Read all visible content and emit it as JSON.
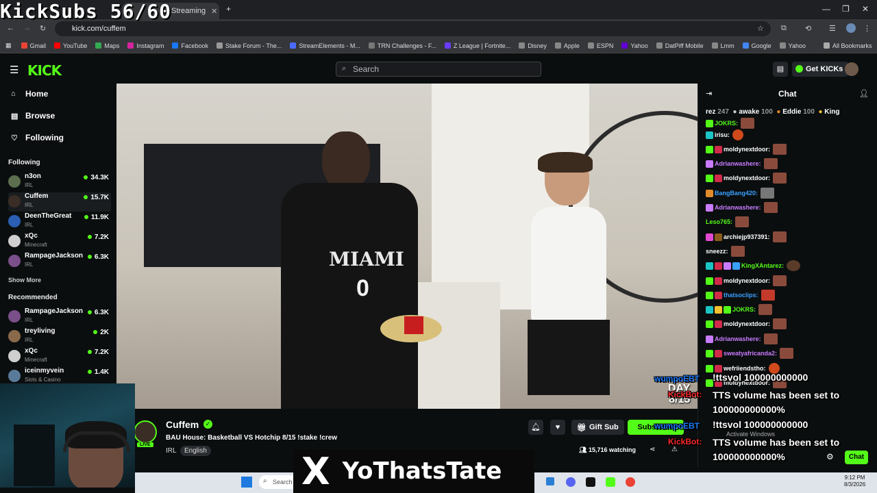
{
  "overlay_title": "KickSubs 56/60",
  "browser": {
    "tabs": [
      "Streaming"
    ],
    "url": "kick.com/cuffem",
    "bookmarks": [
      "Gmail",
      "YouTube",
      "Maps",
      "Instagram",
      "Facebook",
      "Stake Forum - The...",
      "StreamElements - M...",
      "TRN Challenges - F...",
      "Z League | Fortnite...",
      "Disney",
      "Apple",
      "ESPN",
      "Yahoo",
      "DatPiff Mobile",
      "Lmm",
      "Google",
      "Yahoo"
    ],
    "all_bookmarks": "All Bookmarks"
  },
  "kick": {
    "logo": "KICK",
    "search_placeholder": "Search",
    "get_kicks": "Get KICKs"
  },
  "sidebar": {
    "nav": [
      {
        "label": "Home",
        "icon": "home-icon"
      },
      {
        "label": "Browse",
        "icon": "browse-icon"
      },
      {
        "label": "Following",
        "icon": "heart-icon"
      }
    ],
    "following_title": "Following",
    "following": [
      {
        "name": "n3on",
        "category": "IRL",
        "viewers": "34.3K"
      },
      {
        "name": "Cuffem",
        "category": "IRL",
        "viewers": "15.7K"
      },
      {
        "name": "DeenTheGreat",
        "category": "IRL",
        "viewers": "11.9K"
      },
      {
        "name": "xQc",
        "category": "Minecraft",
        "viewers": "7.2K"
      },
      {
        "name": "RampageJackson",
        "category": "IRL",
        "viewers": "6.3K"
      }
    ],
    "show_more": "Show More",
    "recommended_title": "Recommended",
    "recommended": [
      {
        "name": "RampageJackson",
        "category": "IRL",
        "viewers": "6.3K"
      },
      {
        "name": "treyliving",
        "category": "IRL",
        "viewers": "2K"
      },
      {
        "name": "xQc",
        "category": "Minecraft",
        "viewers": "7.2K"
      },
      {
        "name": "iceinmyvein",
        "category": "Slots & Casino",
        "viewers": "1.4K"
      }
    ]
  },
  "video": {
    "day_label": "DAY",
    "day_count": "8/15"
  },
  "stream": {
    "streamer": "Cuffem",
    "live": "LIVE",
    "title": "BAU House: Basketball VS Hotchip 8/15 !stake !crew",
    "tags": [
      "IRL",
      "English"
    ],
    "gift_sub": "Gift Sub",
    "subscribe": "Subscribe",
    "watching": "15,716 watching"
  },
  "chat": {
    "title": "Chat",
    "leaderboard": [
      {
        "name": "rez",
        "score": "247"
      },
      {
        "name": "awake",
        "score": "100"
      },
      {
        "name": "Eddie",
        "score": "100"
      },
      {
        "name": "King",
        "score": ""
      }
    ],
    "messages": [
      {
        "user": "JOKRS:",
        "color": "#53fc18"
      },
      {
        "user": "irisu:",
        "color": "#ffffff"
      },
      {
        "user": "moldynextdoor:",
        "color": "#ffffff"
      },
      {
        "user": "Adrianwashere:",
        "color": "#c97bff"
      },
      {
        "user": "moldynextdoor:",
        "color": "#ffffff"
      },
      {
        "user": "BangBang420:",
        "color": "#3aa0ff"
      },
      {
        "user": "Adrianwashere:",
        "color": "#c97bff"
      },
      {
        "user": "Leso765:",
        "color": "#53fc18"
      },
      {
        "user": "archiejp937391:",
        "color": "#ffffff"
      },
      {
        "user": "sneezz:",
        "color": "#ffffff"
      },
      {
        "user": "KingXAntarez:",
        "color": "#53fc18"
      },
      {
        "user": "moldynextdoor:",
        "color": "#ffffff"
      },
      {
        "user": "thatsoclips:",
        "color": "#3aa0ff"
      },
      {
        "user": "JOKRS:",
        "color": "#53fc18"
      },
      {
        "user": "moldynextdoor:",
        "color": "#ffffff"
      },
      {
        "user": "Adrianwashere:",
        "color": "#c97bff"
      },
      {
        "user": "sweatyafricanda2:",
        "color": "#c97bff"
      },
      {
        "user": "wefriiendstho:",
        "color": "#ffffff"
      },
      {
        "user": "moldynextdoor:",
        "color": "#ffffff"
      }
    ],
    "send_button": "Chat"
  },
  "tts_overlay": {
    "user1": "wumpoEBT",
    "cmd1": "!ttsvol 100000000000",
    "bot1": "KickBot:",
    "reply1": "TTS volume has been set to 100000000000%",
    "user2": "wumpoEBT",
    "cmd2": "!ttsvol 100000000000",
    "bot2": "KickBot:",
    "reply2": "TTS volume has been set to 100000000000%",
    "activate_windows": "Activate Windows"
  },
  "watermark": {
    "logo": "X",
    "handle": "YoThatsTate"
  },
  "taskbar": {
    "search": "Search",
    "time": "9:12 PM",
    "date": "8/3/2026"
  },
  "colors": {
    "kick_green": "#53fc18",
    "background": "#0b0e0f"
  }
}
